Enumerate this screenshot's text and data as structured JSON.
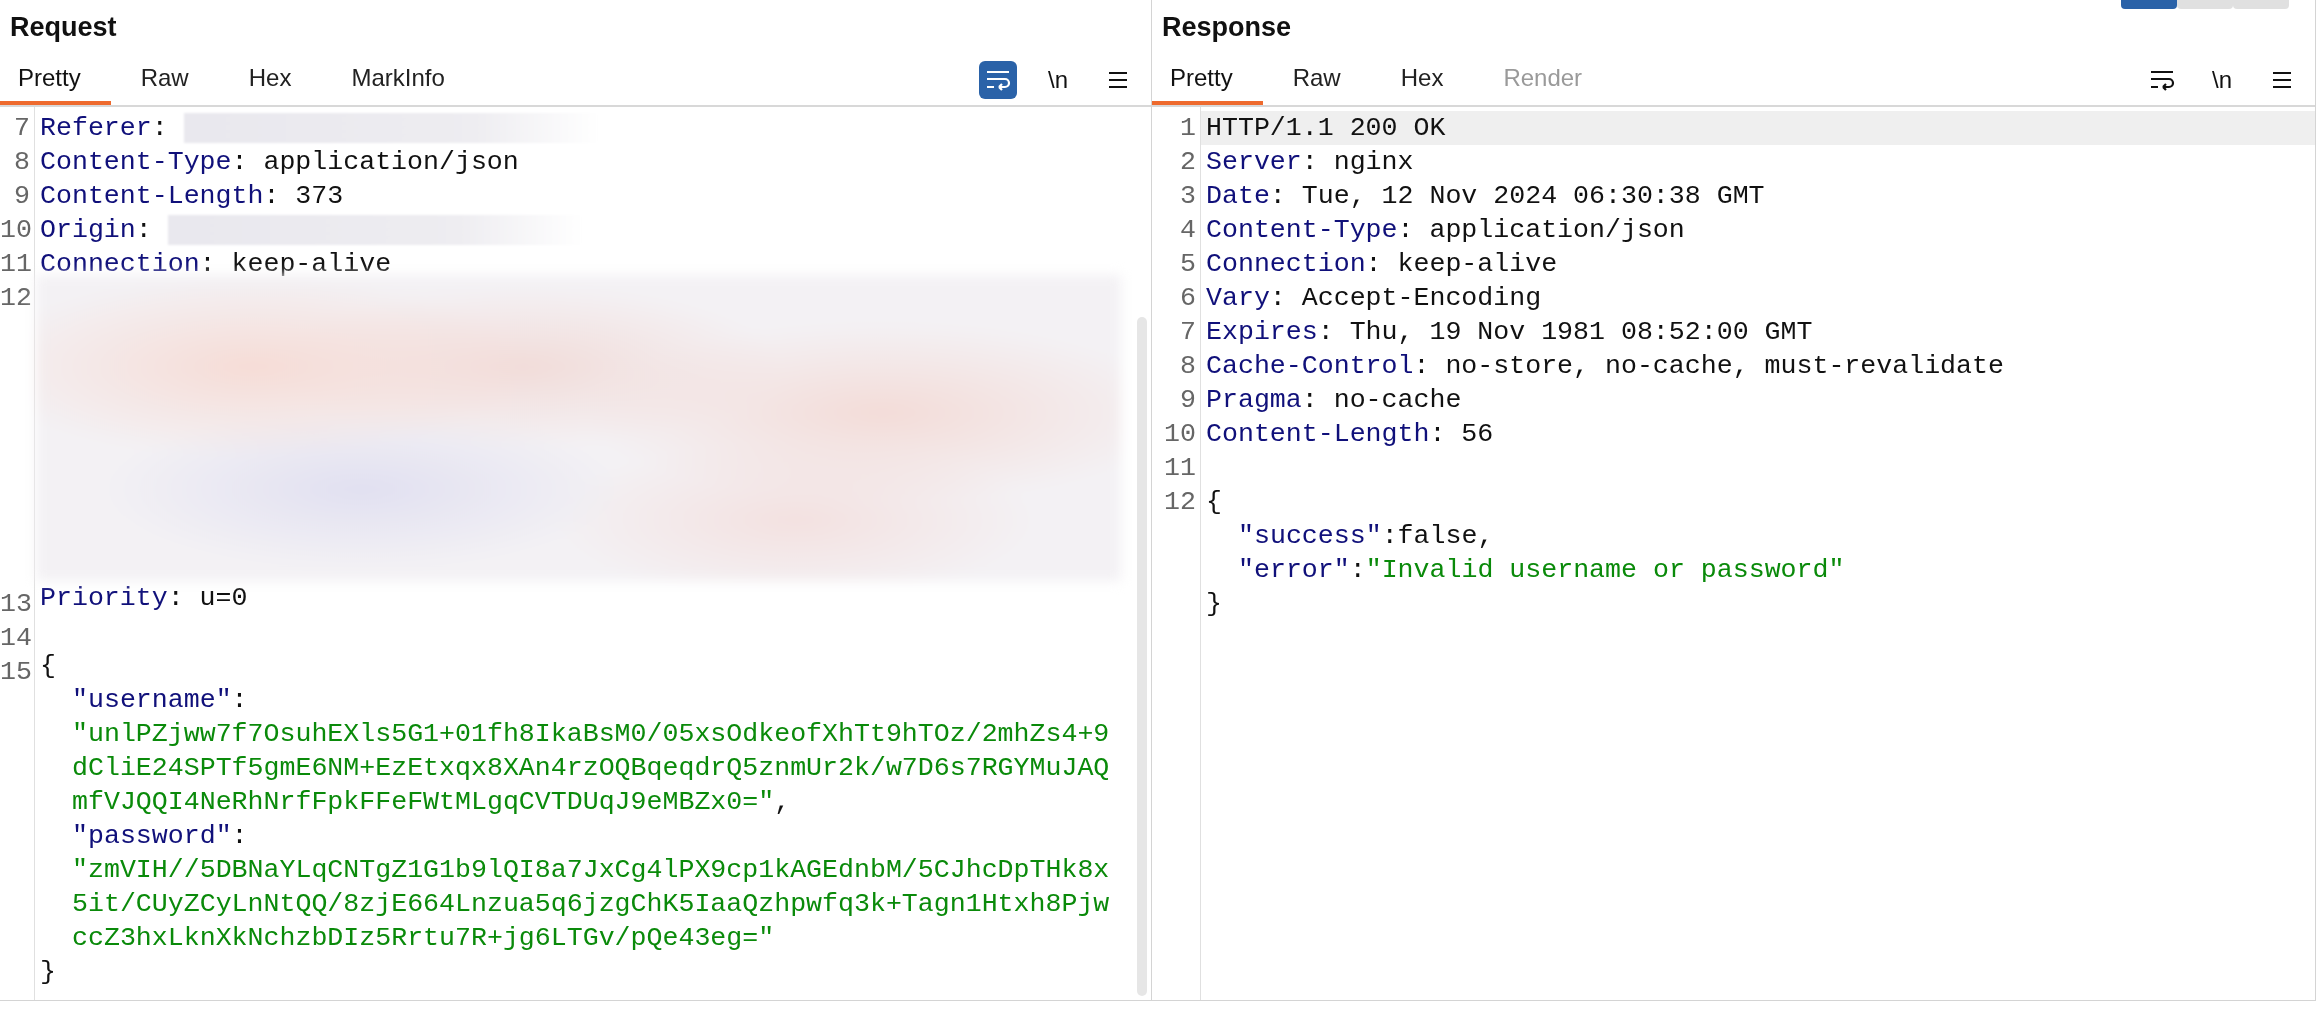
{
  "request": {
    "title": "Request",
    "tabs": [
      {
        "label": "Pretty",
        "selected": true,
        "disabled": false
      },
      {
        "label": "Raw",
        "selected": false,
        "disabled": false
      },
      {
        "label": "Hex",
        "selected": false,
        "disabled": false
      },
      {
        "label": "MarkInfo",
        "selected": false,
        "disabled": false
      }
    ],
    "toolbar": {
      "wrap_on": true,
      "newline_label": "\\n"
    },
    "lines": [
      {
        "number": "7",
        "indented": false,
        "segments": [
          {
            "kind": "key",
            "text": "Referer"
          },
          {
            "kind": "plain",
            "text": ": "
          },
          {
            "kind": "redacted"
          }
        ]
      },
      {
        "number": "8",
        "indented": false,
        "segments": [
          {
            "kind": "key",
            "text": "Content-Type"
          },
          {
            "kind": "plain",
            "text": ": application/json"
          }
        ]
      },
      {
        "number": "9",
        "indented": false,
        "segments": [
          {
            "kind": "key",
            "text": "Content-Length"
          },
          {
            "kind": "plain",
            "text": ": 373"
          }
        ]
      },
      {
        "number": "10",
        "indented": false,
        "segments": [
          {
            "kind": "key",
            "text": "Origin"
          },
          {
            "kind": "plain",
            "text": ": "
          },
          {
            "kind": "redacted"
          }
        ]
      },
      {
        "number": "11",
        "indented": false,
        "segments": [
          {
            "kind": "key",
            "text": "Connection"
          },
          {
            "kind": "plain",
            "text": ": keep-alive"
          }
        ]
      },
      {
        "number": "12",
        "indented": false,
        "segments": [
          {
            "kind": "redacted-block"
          }
        ]
      },
      {
        "number": "13",
        "indented": false,
        "segments": [
          {
            "kind": "key",
            "text": "Priority"
          },
          {
            "kind": "plain",
            "text": ": u=0"
          }
        ]
      },
      {
        "number": "14",
        "indented": false
      },
      {
        "number": "15",
        "indented": false,
        "segments": [
          {
            "kind": "plain",
            "text": "{"
          }
        ]
      },
      {
        "indented": true,
        "segments": [
          {
            "kind": "key",
            "text": "\"username\""
          },
          {
            "kind": "plain",
            "text": ":"
          }
        ]
      },
      {
        "indented": true,
        "segments": [
          {
            "kind": "string",
            "text": "\"unlPZjww7f7OsuhEXls5G1+01fh8IkaBsM0/05xsOdkeofXhTt9hTOz/2mhZs4+9dCliE24SPTf5gmE6NM+EzEtxqx8XAn4rzOQBqeqdrQ5znmUr2k/w7D6s7RGYMuJAQmfVJQQI4NeRhNrfFpkFFeFWtMLgqCVTDUqJ9eMBZx0=\""
          },
          {
            "kind": "plain",
            "text": ","
          }
        ]
      },
      {
        "indented": true,
        "segments": [
          {
            "kind": "key",
            "text": "\"password\""
          },
          {
            "kind": "plain",
            "text": ":"
          }
        ]
      },
      {
        "indented": true,
        "segments": [
          {
            "kind": "string",
            "text": "\"zmVIH//5DBNaYLqCNTgZ1G1b9lQI8a7JxCg4lPX9cp1kAGEdnbM/5CJhcDpTHk8x5it/CUyZCyLnNtQQ/8zjE664Lnzua5q6jzgChK5IaaQzhpwfq3k+Tagn1Htxh8PjwccZ3hxLknXkNchzbDIz5Rrtu7R+jg6LTGv/pQe43eg=\""
          }
        ]
      },
      {
        "indented": false,
        "segments": [
          {
            "kind": "plain",
            "text": "}"
          }
        ]
      }
    ]
  },
  "response": {
    "title": "Response",
    "layout_toggle": [
      {
        "selected": true
      },
      {
        "selected": false
      },
      {
        "selected": false
      }
    ],
    "tabs": [
      {
        "label": "Pretty",
        "selected": true,
        "disabled": false
      },
      {
        "label": "Raw",
        "selected": false,
        "disabled": false
      },
      {
        "label": "Hex",
        "selected": false,
        "disabled": false
      },
      {
        "label": "Render",
        "selected": false,
        "disabled": true
      }
    ],
    "toolbar": {
      "wrap_on": false,
      "newline_label": "\\n"
    },
    "lines": [
      {
        "number": "1",
        "highlighted": true,
        "indented": false,
        "segments": [
          {
            "kind": "plain",
            "text": "HTTP/1.1 200 OK"
          }
        ]
      },
      {
        "number": "2",
        "highlighted": false,
        "indented": false,
        "segments": [
          {
            "kind": "key",
            "text": "Server"
          },
          {
            "kind": "plain",
            "text": ": nginx"
          }
        ]
      },
      {
        "number": "3",
        "highlighted": false,
        "indented": false,
        "segments": [
          {
            "kind": "key",
            "text": "Date"
          },
          {
            "kind": "plain",
            "text": ": Tue, 12 Nov 2024 06:30:38 GMT"
          }
        ]
      },
      {
        "number": "4",
        "highlighted": false,
        "indented": false,
        "segments": [
          {
            "kind": "key",
            "text": "Content-Type"
          },
          {
            "kind": "plain",
            "text": ": application/json"
          }
        ]
      },
      {
        "number": "5",
        "highlighted": false,
        "indented": false,
        "segments": [
          {
            "kind": "key",
            "text": "Connection"
          },
          {
            "kind": "plain",
            "text": ": keep-alive"
          }
        ]
      },
      {
        "number": "6",
        "highlighted": false,
        "indented": false,
        "segments": [
          {
            "kind": "key",
            "text": "Vary"
          },
          {
            "kind": "plain",
            "text": ": Accept-Encoding"
          }
        ]
      },
      {
        "number": "7",
        "highlighted": false,
        "indented": false,
        "segments": [
          {
            "kind": "key",
            "text": "Expires"
          },
          {
            "kind": "plain",
            "text": ": Thu, 19 Nov 1981 08:52:00 GMT"
          }
        ]
      },
      {
        "number": "8",
        "highlighted": false,
        "indented": false,
        "segments": [
          {
            "kind": "key",
            "text": "Cache-Control"
          },
          {
            "kind": "plain",
            "text": ": no-store, no-cache, must-revalidate"
          }
        ]
      },
      {
        "number": "9",
        "highlighted": false,
        "indented": false,
        "segments": [
          {
            "kind": "key",
            "text": "Pragma"
          },
          {
            "kind": "plain",
            "text": ": no-cache"
          }
        ]
      },
      {
        "number": "10",
        "highlighted": false,
        "indented": false,
        "segments": [
          {
            "kind": "key",
            "text": "Content-Length"
          },
          {
            "kind": "plain",
            "text": ": 56"
          }
        ]
      },
      {
        "number": "11",
        "highlighted": false,
        "indented": false
      },
      {
        "number": "12",
        "highlighted": false,
        "indented": false,
        "segments": [
          {
            "kind": "plain",
            "text": "{"
          }
        ]
      },
      {
        "highlighted": false,
        "indented": true,
        "segments": [
          {
            "kind": "key",
            "text": "\"success\""
          },
          {
            "kind": "plain",
            "text": ":false,"
          }
        ]
      },
      {
        "highlighted": false,
        "indented": true,
        "segments": [
          {
            "kind": "key",
            "text": "\"error\""
          },
          {
            "kind": "plain",
            "text": ":"
          },
          {
            "kind": "string",
            "text": "\"Invalid username or password\""
          }
        ]
      },
      {
        "highlighted": false,
        "indented": false,
        "segments": [
          {
            "kind": "plain",
            "text": "}"
          }
        ]
      }
    ]
  }
}
